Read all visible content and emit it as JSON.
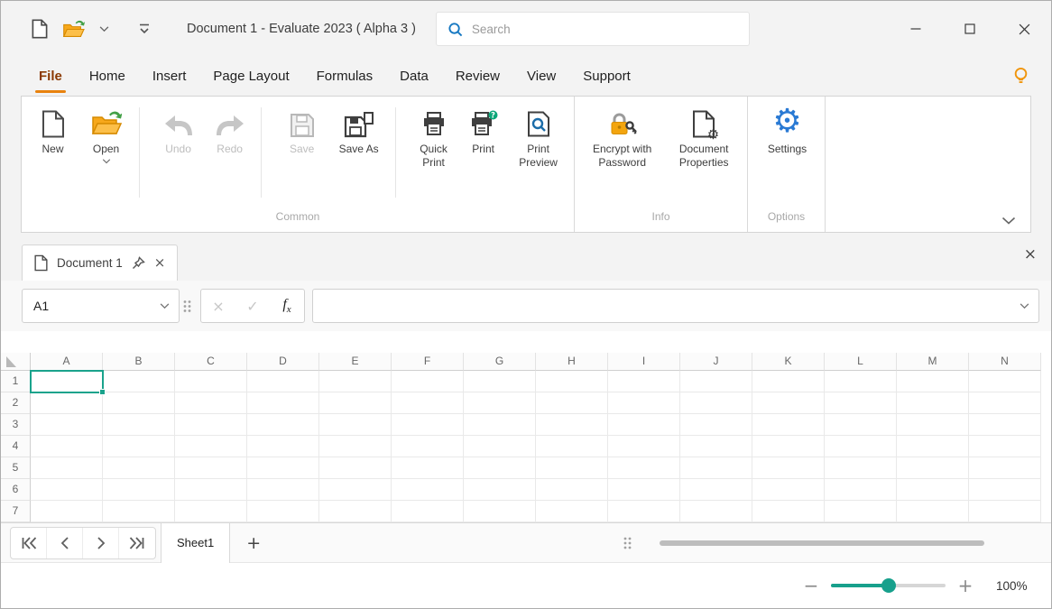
{
  "icons": {
    "gear": "⚙",
    "close": "×",
    "check": "✓",
    "plus": "+",
    "minus": "−"
  },
  "titlebar": {
    "title": "Document 1 - Evaluate 2023 ( Alpha 3 )"
  },
  "search": {
    "placeholder": "Search"
  },
  "ribbon": {
    "active_tab": "File",
    "tabs": [
      {
        "label": "File"
      },
      {
        "label": "Home"
      },
      {
        "label": "Insert"
      },
      {
        "label": "Page Layout"
      },
      {
        "label": "Formulas"
      },
      {
        "label": "Data"
      },
      {
        "label": "Review"
      },
      {
        "label": "View"
      },
      {
        "label": "Support"
      }
    ],
    "buttons": {
      "new": "New",
      "open": "Open",
      "undo": "Undo",
      "redo": "Redo",
      "save": "Save",
      "save_as": "Save As",
      "quick_print": "Quick Print",
      "print": "Print",
      "print_preview": "Print Preview",
      "encrypt": "Encrypt with Password",
      "doc_properties": "Document Properties",
      "settings": "Settings"
    },
    "group_labels": {
      "common": "Common",
      "info": "Info",
      "options": "Options"
    }
  },
  "document_tabs": [
    {
      "label": "Document 1",
      "active": true
    }
  ],
  "formula_bar": {
    "name_box": "A1",
    "fx_f": "f",
    "fx_x": "x",
    "value": ""
  },
  "grid": {
    "columns": [
      "A",
      "B",
      "C",
      "D",
      "E",
      "F",
      "G",
      "H",
      "I",
      "J",
      "K",
      "L",
      "M",
      "N"
    ],
    "rows": [
      "1",
      "2",
      "3",
      "4",
      "5",
      "6",
      "7"
    ],
    "selected_cell": "A1"
  },
  "sheet_bar": {
    "tabs": [
      {
        "label": "Sheet1",
        "active": true
      }
    ]
  },
  "status_bar": {
    "zoom": "100%"
  }
}
